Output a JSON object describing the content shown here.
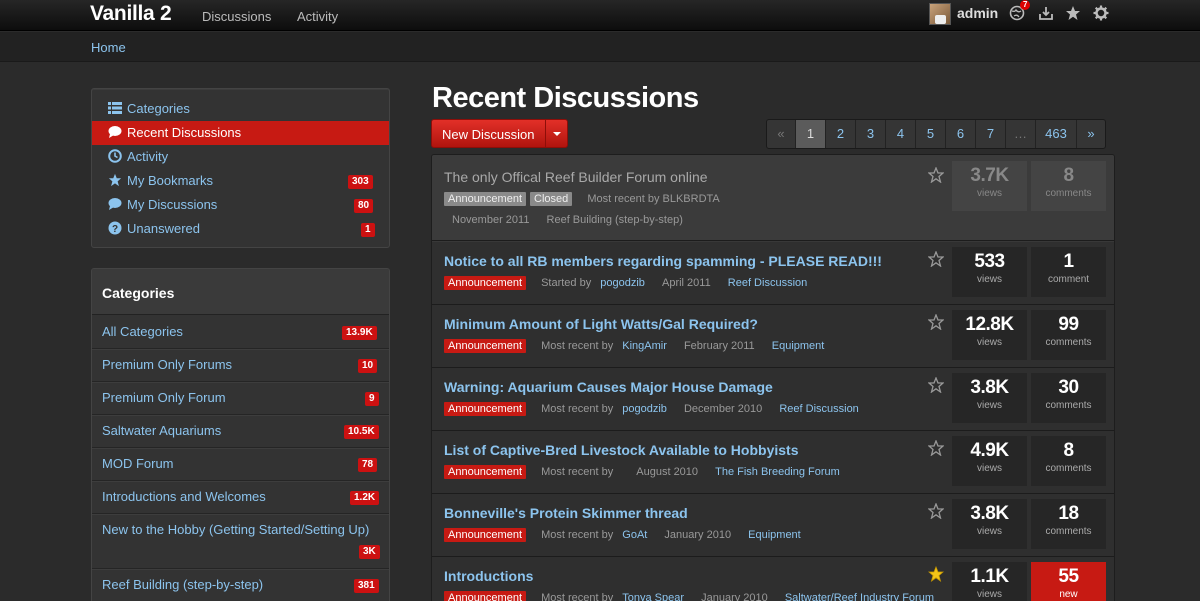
{
  "header": {
    "brand": "Vanilla 2",
    "nav": [
      "Discussions",
      "Activity"
    ],
    "username": "admin",
    "notification_count": "7",
    "icons": [
      "avatar",
      "notifications-globe-icon",
      "inbox-download-icon",
      "bookmark-star-icon",
      "settings-gear-icon"
    ]
  },
  "breadcrumb": {
    "home": "Home"
  },
  "sidebar": {
    "menu": [
      {
        "label": "Categories",
        "icon": "list-icon",
        "count": ""
      },
      {
        "label": "Recent Discussions",
        "icon": "speech-bubble-icon",
        "count": "",
        "active": true
      },
      {
        "label": "Activity",
        "icon": "clock-icon",
        "count": ""
      },
      {
        "label": "My Bookmarks",
        "icon": "star-icon",
        "count": "303"
      },
      {
        "label": "My Discussions",
        "icon": "speech-bubble-icon",
        "count": "80"
      },
      {
        "label": "Unanswered",
        "icon": "question-icon",
        "count": "1"
      }
    ],
    "categories_title": "Categories",
    "categories": [
      {
        "name": "All Categories",
        "count": "13.9K"
      },
      {
        "name": "Premium Only Forums",
        "count": "10"
      },
      {
        "name": "Premium Only Forum",
        "count": "9"
      },
      {
        "name": "Saltwater Aquariums",
        "count": "10.5K"
      },
      {
        "name": "MOD Forum",
        "count": "78"
      },
      {
        "name": "Introductions and Welcomes",
        "count": "1.2K"
      },
      {
        "name": "New to the Hobby (Getting Started/Setting Up)",
        "count": "3K"
      },
      {
        "name": "Reef Building (step-by-step)",
        "count": "381"
      }
    ]
  },
  "main": {
    "title": "Recent Discussions",
    "new_button": "New Discussion",
    "pager": [
      "«",
      "1",
      "2",
      "3",
      "4",
      "5",
      "6",
      "7",
      "…",
      "463",
      "»"
    ],
    "current_page": "1",
    "discussions": [
      {
        "title": "The only Offical Reef Builder Forum online",
        "tags": [
          "Announcement",
          "Closed"
        ],
        "prefix": "Most recent by",
        "user": "BLKBRDTA",
        "date": "November 2011",
        "category": "Reef Building (step-by-step)",
        "views": "3.7K",
        "views_label": "views",
        "comments": "8",
        "comments_label": "comments",
        "starred": false,
        "announcement": true
      },
      {
        "title": "Notice to all RB members regarding spamming - PLEASE READ!!!",
        "tags": [
          "Announcement"
        ],
        "prefix": "Started by",
        "user": "pogodzib",
        "date": "April 2011",
        "category": "Reef Discussion",
        "views": "533",
        "views_label": "views",
        "comments": "1",
        "comments_label": "comment",
        "starred": false
      },
      {
        "title": "Minimum Amount of Light Watts/Gal Required?",
        "tags": [
          "Announcement"
        ],
        "prefix": "Most recent by",
        "user": "KingAmir",
        "date": "February 2011",
        "category": "Equipment",
        "views": "12.8K",
        "views_label": "views",
        "comments": "99",
        "comments_label": "comments",
        "starred": false
      },
      {
        "title": "Warning: Aquarium Causes Major House Damage",
        "tags": [
          "Announcement"
        ],
        "prefix": "Most recent by",
        "user": "pogodzib",
        "date": "December 2010",
        "category": "Reef Discussion",
        "views": "3.8K",
        "views_label": "views",
        "comments": "30",
        "comments_label": "comments",
        "starred": false
      },
      {
        "title": "List of Captive-Bred Livestock Available to Hobbyists",
        "tags": [
          "Announcement"
        ],
        "prefix": "Most recent by",
        "user": "",
        "date": "August 2010",
        "category": "The Fish Breeding Forum",
        "views": "4.9K",
        "views_label": "views",
        "comments": "8",
        "comments_label": "comments",
        "starred": false
      },
      {
        "title": "Bonneville's Protein Skimmer thread",
        "tags": [
          "Announcement"
        ],
        "prefix": "Most recent by",
        "user": "GoAt",
        "date": "January 2010",
        "category": "Equipment",
        "views": "3.8K",
        "views_label": "views",
        "comments": "18",
        "comments_label": "comments",
        "starred": false
      },
      {
        "title": "Introductions",
        "tags": [
          "Announcement"
        ],
        "prefix": "Most recent by",
        "user": "Tonya Spear",
        "date": "January 2010",
        "category": "Saltwater/Reef Industry Forum",
        "views": "1.1K",
        "views_label": "views",
        "comments": "55",
        "comments_label": "new",
        "starred": true,
        "new_highlight": true
      }
    ]
  },
  "colors": {
    "accent_red": "#c71a13",
    "link_blue": "#8cc4ee",
    "star_gold": "#f5c518"
  }
}
